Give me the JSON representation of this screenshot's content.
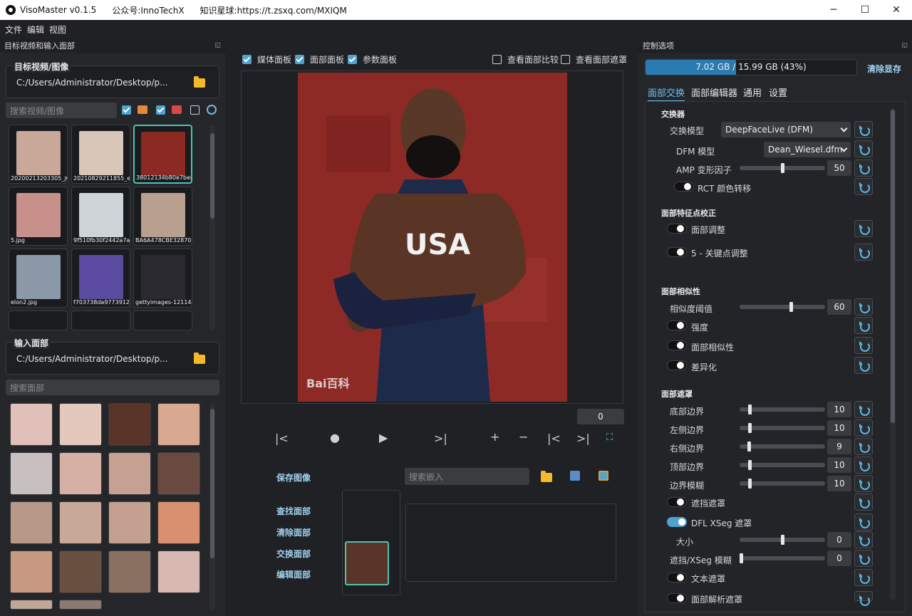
{
  "titlebar": {
    "app": "VisoMaster v0.1.5",
    "wechat": "公众号:InnoTechX",
    "planet": "知识星球:https://t.zsxq.com/MXIQM"
  },
  "menu": [
    "文件",
    "编辑",
    "视图"
  ],
  "left": {
    "panel_title": "目标视频和输入面部",
    "target_group": "目标视频/图像",
    "target_path": "C:/Users/Administrator/Desktop/p...",
    "search_media_placeholder": "搜索视频/图像",
    "media": [
      {
        "caption": "20200213203305_jGu",
        "color": "#c9a89a"
      },
      {
        "caption": "20210829211855_e0b",
        "color": "#d8c6b8"
      },
      {
        "caption": "38012134b80e7bee54",
        "color": "#8a2a22"
      },
      {
        "caption": "5.jpg",
        "color": "#c8908a"
      },
      {
        "caption": "9f510fb30f2442a7a75",
        "color": "#cfd4d8"
      },
      {
        "caption": "BA6A478CBE3287029",
        "color": "#b8a090"
      },
      {
        "caption": "elon2.jpg",
        "color": "#8a98a8"
      },
      {
        "caption": "f703738da9773912b3",
        "color": "#5a4aa0"
      },
      {
        "caption": "gettyimages-1211442",
        "color": "#2a2a30"
      }
    ],
    "input_group": "输入面部",
    "input_path": "C:/Users/Administrator/Desktop/p...",
    "search_face_placeholder": "搜索面部",
    "faces": [
      "#e0c0b8",
      "#e4c8bc",
      "#5a3428",
      "#d8a890",
      "#c8c0c0",
      "#d6b0a4",
      "#c6a090",
      "#6a4a40",
      "#b89888",
      "#c8a898",
      "#c4a090",
      "#d89070",
      "#c89880",
      "#6a5040",
      "#8a7060",
      "#d8b8b0"
    ]
  },
  "center": {
    "checks": [
      {
        "label": "媒体面板",
        "on": true
      },
      {
        "label": "面部面板",
        "on": true
      },
      {
        "label": "参数面板",
        "on": true
      }
    ],
    "checks_right": [
      {
        "label": "查看面部比较",
        "on": false
      },
      {
        "label": "查看面部遮罩",
        "on": false
      }
    ],
    "watermark": "Bai百科",
    "frame": "0",
    "save_image": "保存图像",
    "search_embed_placeholder": "搜索嵌入",
    "find_face": "查找面部",
    "clear_face": "清除面部",
    "swap_face": "交换面部",
    "edit_face": "编辑面部"
  },
  "right": {
    "panel_title": "控制选项",
    "memory": {
      "text": "7.02 GB / 15.99 GB (43%)",
      "fraction": 0.43
    },
    "clear_memory": "清除显存",
    "tabs": [
      "面部交换",
      "面部编辑器",
      "通用",
      "设置"
    ],
    "sections": {
      "swapper": "交换器",
      "landmark": "面部特征点校正",
      "similarity": "面部相似性",
      "mask": "面部遮罩"
    },
    "swap_model_label": "交换模型",
    "swap_model_value": "DeepFaceLive (DFM)",
    "dfm_label": "DFM 模型",
    "dfm_value": "Dean_Wiesel.dfm",
    "amp_label": "AMP 变形因子",
    "amp_value": "50",
    "amp_level": 0.5,
    "rct_label": "RCT 颜色转移",
    "face_adjust": "面部调整",
    "kp_adjust": "5 - 关键点调整",
    "sim_thresh_label": "相似度阈值",
    "sim_thresh_value": "60",
    "sim_thresh_level": 0.6,
    "strength": "强度",
    "face_sim": "面部相似性",
    "diff": "差异化",
    "bottom_border": "底部边界",
    "bottom_value": "10",
    "left_border": "左侧边界",
    "left_value": "10",
    "right_border": "右侧边界",
    "right_value": "9",
    "top_border": "顶部边界",
    "top_value": "10",
    "blur_border": "边界模糊",
    "blur_value": "10",
    "occlusion": "遮挡遮罩",
    "xseg": "DFL XSeg 遮罩",
    "size_label": "大小",
    "size_value": "0",
    "xseg_blur_label": "遮挡/XSeg 模糊",
    "xseg_blur_value": "0",
    "text_mask": "文本遮罩",
    "parse_mask": "面部解析遮罩"
  }
}
